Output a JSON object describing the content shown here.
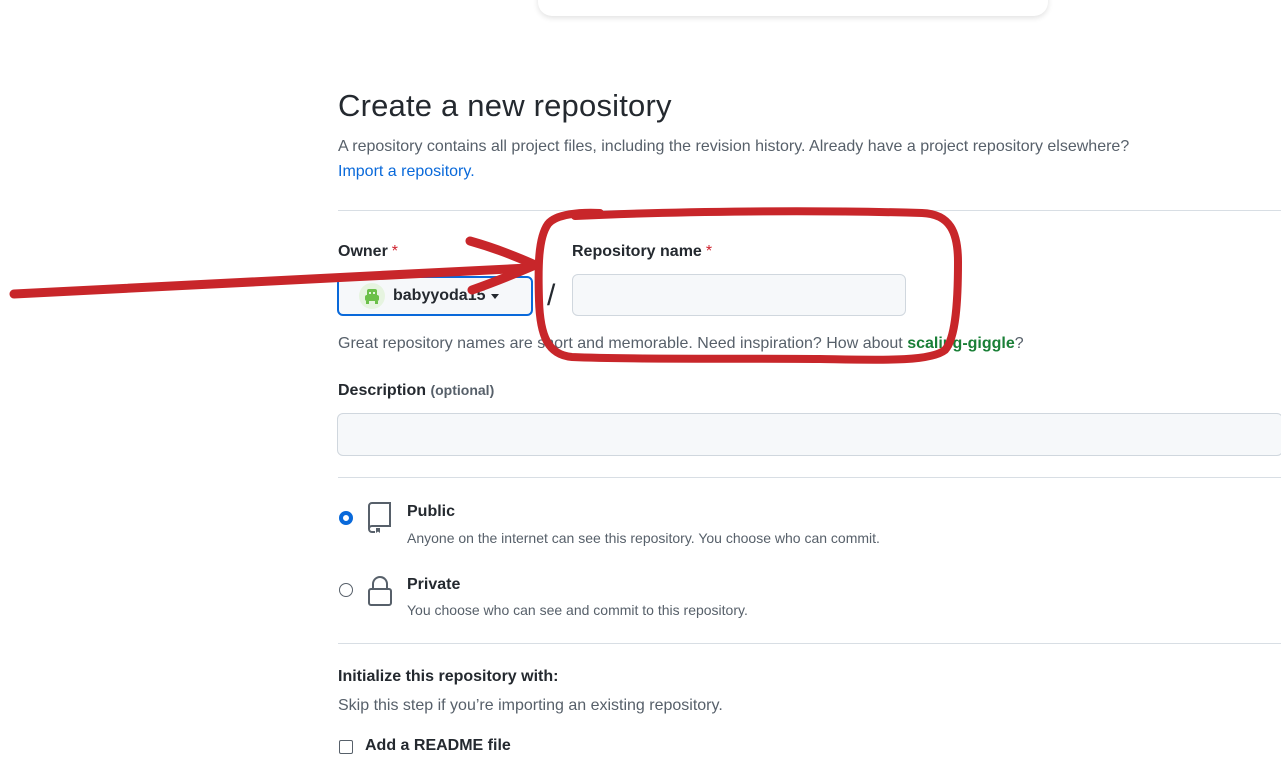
{
  "header": {
    "title": "Create a new repository",
    "description": "A repository contains all project files, including the revision history. Already have a project repository elsewhere?",
    "import_link": "Import a repository."
  },
  "owner": {
    "label": "Owner",
    "required_mark": "*",
    "selected": "babyyoda15",
    "separator": "/"
  },
  "repo_name": {
    "label": "Repository name",
    "required_mark": "*",
    "value": "",
    "hint_prefix": "Great repository names are short and memorable. Need inspiration? How about ",
    "suggestion": "scaling-giggle",
    "hint_suffix": "?"
  },
  "description_field": {
    "label": "Description",
    "optional": "(optional)",
    "value": ""
  },
  "visibility": {
    "public": {
      "title": "Public",
      "desc": "Anyone on the internet can see this repository. You choose who can commit.",
      "checked": true
    },
    "private": {
      "title": "Private",
      "desc": "You choose who can see and commit to this repository.",
      "checked": false
    }
  },
  "initialize": {
    "title": "Initialize this repository with:",
    "desc": "Skip this step if you’re importing an existing repository.",
    "readme_label": "Add a README file"
  },
  "colors": {
    "annotation": "#c8262a",
    "link": "#0969da",
    "suggestion": "#1a7f37",
    "required": "#cf222e"
  },
  "icons": [
    "avatar-icon",
    "caret-down-icon",
    "repo-icon",
    "lock-icon"
  ]
}
